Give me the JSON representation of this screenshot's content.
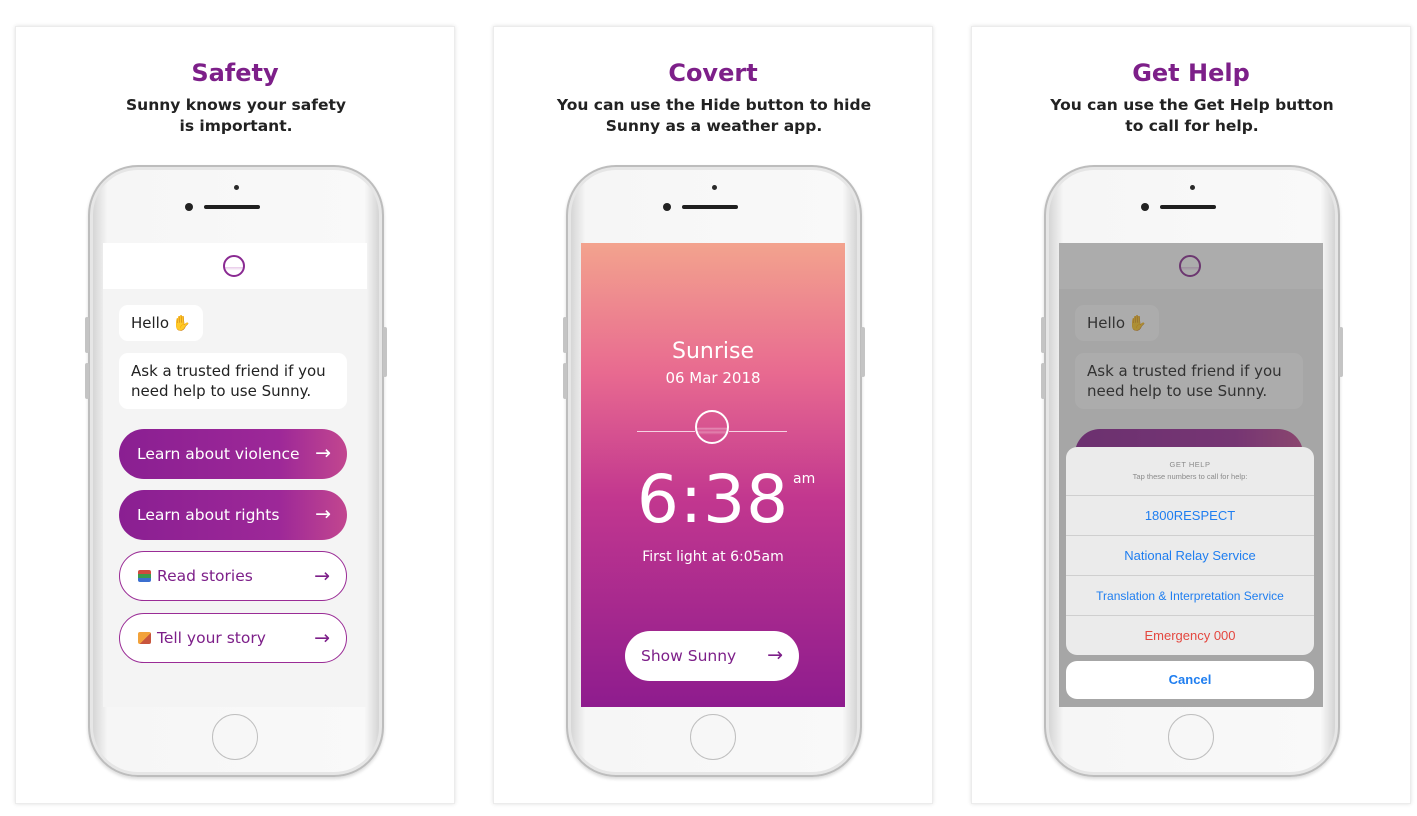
{
  "panels": [
    {
      "title": "Safety",
      "subtitle_line1": "Sunny knows your safety",
      "subtitle_line2": "is important."
    },
    {
      "title": "Covert",
      "subtitle_line1": "You can use the Hide button to hide",
      "subtitle_line2": "Sunny as a weather app."
    },
    {
      "title": "Get Help",
      "subtitle_line1": "You can use the Get Help button",
      "subtitle_line2": "to call for help."
    }
  ],
  "chat": {
    "greeting": "Hello",
    "message_line1": "Ask a trusted friend if you",
    "message_line2": "need help to use Sunny.",
    "buttons": [
      {
        "label": "Learn about violence",
        "style": "filled"
      },
      {
        "label": "Learn about rights",
        "style": "filled"
      },
      {
        "label": "Read stories",
        "style": "outline",
        "icon": "books-emoji"
      },
      {
        "label": "Tell your story",
        "style": "outline",
        "icon": "notebook-emoji"
      }
    ],
    "arrow": "→",
    "wave_icon": "waving-hand-icon"
  },
  "weather": {
    "title": "Sunrise",
    "date": "06 Mar 2018",
    "time": "6:38",
    "ampm": "am",
    "first_light": "First light at 6:05am",
    "show_button": "Show Sunny"
  },
  "get_help": {
    "header": "GET HELP",
    "instruction": "Tap these numbers to call for help:",
    "options": [
      "1800RESPECT",
      "National Relay Service",
      "Translation & Interpretation Service",
      "Emergency 000"
    ],
    "cancel": "Cancel"
  },
  "colors": {
    "brand_purple": "#7d1f89",
    "ios_blue": "#1f7ef0",
    "emergency_red": "#e4473f"
  }
}
